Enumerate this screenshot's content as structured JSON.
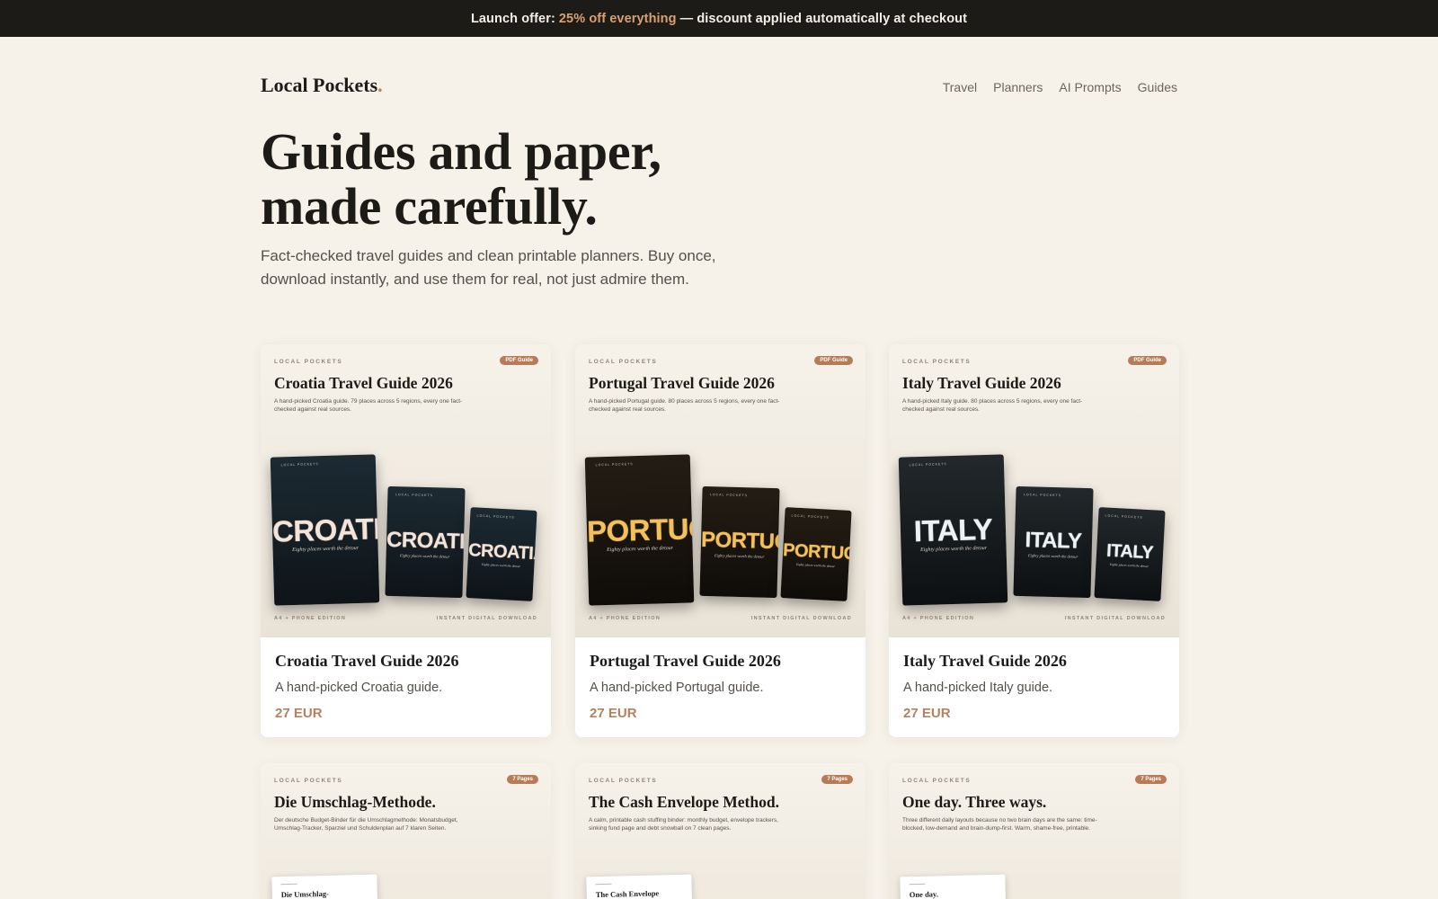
{
  "banner": {
    "prefix": "Launch offer:",
    "highlight": "25% off everything",
    "suffix": "— discount applied automatically at checkout"
  },
  "header": {
    "logo": "Local Pockets",
    "logo_dot": ".",
    "nav": [
      "Travel",
      "Planners",
      "AI Prompts",
      "Guides"
    ]
  },
  "hero": {
    "title_line1": "Guides and paper,",
    "title_line2": "made carefully.",
    "subtitle": "Fact-checked travel guides and clean printable planners. Buy once, download instantly, and use them for real, not just admire them."
  },
  "colors": {
    "accent": "#b38260",
    "badge": "#b77b58",
    "banner_bg": "#1d1b18",
    "page_bg": "#f6f2ea"
  },
  "products": [
    {
      "cover_brand": "LOCAL POCKETS",
      "badge": "PDF Guide",
      "cover_title": "Croatia Travel Guide 2026",
      "cover_desc": "A hand-picked Croatia guide. 79 places across 5 regions, every one fact-checked against real sources.",
      "book_word": "CROATIA",
      "book_tagline": "Eighty places worth the detour",
      "foot_left": "A4 + PHONE EDITION",
      "foot_right": "INSTANT DIGITAL DOWNLOAD",
      "title": "Croatia Travel Guide 2026",
      "desc": "A hand-picked Croatia guide.",
      "price": "27 EUR",
      "theme": {
        "bg1": "#1c2a33",
        "bg2": "#0e1418",
        "word": "#f1e4d8",
        "word_accent": "#e2a99a"
      }
    },
    {
      "cover_brand": "LOCAL POCKETS",
      "badge": "PDF Guide",
      "cover_title": "Portugal Travel Guide 2026",
      "cover_desc": "A hand-picked Portugal guide. 80 places across 5 regions, every one fact-checked against real sources.",
      "book_word": "PORTUGAL",
      "book_tagline": "Eighty places worth the detour",
      "foot_left": "A4 + PHONE EDITION",
      "foot_right": "INSTANT DIGITAL DOWNLOAD",
      "title": "Portugal Travel Guide 2026",
      "desc": "A hand-picked Portugal guide.",
      "price": "27 EUR",
      "theme": {
        "bg1": "#241d14",
        "bg2": "#0f0c09",
        "word": "#f2c15a",
        "word_accent": "#e8a43a"
      }
    },
    {
      "cover_brand": "LOCAL POCKETS",
      "badge": "PDF Guide",
      "cover_title": "Italy Travel Guide 2026",
      "cover_desc": "A hand-picked Italy guide. 80 places across 5 regions, every one fact-checked against real sources.",
      "book_word": "ITALY",
      "book_tagline": "Eighty places worth the detour",
      "foot_left": "A4 + PHONE EDITION",
      "foot_right": "INSTANT DIGITAL DOWNLOAD",
      "title": "Italy Travel Guide 2026",
      "desc": "A hand-picked Italy guide.",
      "price": "27 EUR",
      "theme": {
        "bg1": "#22282b",
        "bg2": "#0d1012",
        "word": "#eef2f4",
        "word_accent": "#c9d8e0"
      }
    }
  ],
  "planners": [
    {
      "cover_brand": "LOCAL POCKETS",
      "badge": "7 Pages",
      "cover_title": "Die Umschlag-Methode.",
      "cover_desc": "Der deutsche Budget-Binder für die Umschlagmethode: Monatsbudget, Umschlag-Tracker, Sparziel und Schuldenplan auf 7 klaren Seiten.",
      "page_title": "Die Umschlag-"
    },
    {
      "cover_brand": "LOCAL POCKETS",
      "badge": "7 Pages",
      "cover_title": "The Cash Envelope Method.",
      "cover_desc": "A calm, printable cash stuffing binder: monthly budget, envelope trackers, sinking fund page and debt snowball on 7 clean pages.",
      "page_title": "The Cash Envelope"
    },
    {
      "cover_brand": "LOCAL POCKETS",
      "badge": "7 Pages",
      "cover_title": "One day. Three ways.",
      "cover_desc": "Three different daily layouts because no two brain days are the same: time-blocked, low-demand and brain-dump-first. Warm, shame-free, printable.",
      "page_title": "One day."
    }
  ]
}
